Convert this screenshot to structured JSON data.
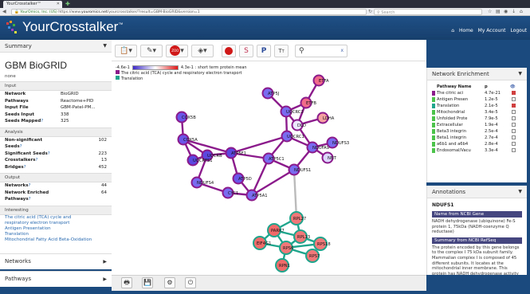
{
  "browser": {
    "tab_title": "YourCrosstalker™",
    "tab_close": "✕",
    "new_tab": "✚",
    "url_org": "YourOmics, Inc. (US)",
    "url_prefix": "https://www.",
    "url_domain": "youromics.net",
    "url_path": "/yourcrosstalker/?result=GBM-BioGRID&version=1",
    "search_placeholder": "Search"
  },
  "header": {
    "title": "YourCrosstalker",
    "trademark": "™",
    "links": [
      "Home",
      "My Account",
      "Logout"
    ]
  },
  "summary": {
    "panel_title": "Summary",
    "dataset_title": "GBM BioGRID",
    "description": "none",
    "input_header": "Input",
    "input_rows": [
      {
        "k": "Network",
        "v": "BioGRID"
      },
      {
        "k": "Pathways",
        "v": "Reactome+PID"
      },
      {
        "k": "Input File",
        "v": "GBM-Patel-PM..."
      },
      {
        "k": "Seeds Input",
        "v": "338"
      },
      {
        "k": "Seeds Mapped",
        "q": "?",
        "v": "325"
      }
    ],
    "analysis_header": "Analysis",
    "analysis_rows": [
      {
        "k": "Non-significant Seeds",
        "q": "?",
        "v": "102"
      },
      {
        "k": "Significant Seeds",
        "q": "?",
        "v": "223"
      },
      {
        "k": "Crosstalkers",
        "q": "?",
        "v": "13"
      },
      {
        "k": "Bridges",
        "q": "?",
        "v": "452"
      }
    ],
    "output_header": "Output",
    "output_rows": [
      {
        "k": "Networks",
        "q": "?",
        "v": "44"
      },
      {
        "k": "Network Enriched Pathways",
        "q": "?",
        "v": "64"
      }
    ],
    "interesting_header": "Interesting",
    "interesting_links": [
      "The citric acid (TCA) cycle and",
      "respiratory electron transport",
      "Antigen Presentation",
      "Translation",
      "Mitochondrial Fatty Acid Beta-Oxidation"
    ],
    "networks_tab": "Networks",
    "pathways_tab": "Pathways"
  },
  "toolbar": {
    "zoom_label": "ZOO",
    "icon_s": "S",
    "icon_p": "P",
    "icon_tt": "T",
    "search_clear": "x"
  },
  "graph": {
    "legend_min": "-4.6e-1",
    "legend_max": "4.3e-1",
    "legend_caption": ": short term protein mean",
    "legend_series": [
      {
        "name": "The citric acid (TCA) cycle and respiratory electron transport",
        "color": "#8b1a8b"
      },
      {
        "name": "Translation",
        "color": "#1fa58c"
      }
    ],
    "nodes": [
      {
        "id": "ETFA",
        "color": "#f06a8a"
      },
      {
        "id": "ATP5J",
        "color": "#7a6cf0"
      },
      {
        "id": "ETFB",
        "color": "#f06a8a"
      },
      {
        "id": "COX5B",
        "color": "#6a56e8"
      },
      {
        "id": "UQCRC2",
        "color": "#7a6cf0"
      },
      {
        "id": "DLD",
        "color": "#ece8ff"
      },
      {
        "id": "LDHA",
        "color": "#f4a0a0"
      },
      {
        "id": "COX5A",
        "color": "#6a56e8"
      },
      {
        "id": "UQCRC1",
        "color": "#7a6cf0"
      },
      {
        "id": "NDUFA9",
        "color": "#7a6cf0"
      },
      {
        "id": "NDUFS3",
        "color": "#7a6cf0"
      },
      {
        "id": "ATP5F1",
        "color": "#5c48e0"
      },
      {
        "id": "UQCRB",
        "color": "#5c48e0"
      },
      {
        "id": "UQCRFS1",
        "color": "#5c48e0"
      },
      {
        "id": "ATP5C1",
        "color": "#7a6cf0"
      },
      {
        "id": "NNT",
        "color": "#ddd8ff"
      },
      {
        "id": "NDUFS1",
        "color": "#7a6cf0"
      },
      {
        "id": "ATP5D",
        "color": "#6a56e8"
      },
      {
        "id": "NDUFS4",
        "color": "#7a6cf0"
      },
      {
        "id": "CYC1",
        "color": "#7a6cf0"
      },
      {
        "id": "ATP5A1",
        "color": "#7a6cf0"
      },
      {
        "id": "RPL27",
        "color": "#f07878"
      },
      {
        "id": "PARK7",
        "color": "#f06a6a"
      },
      {
        "id": "RPL13",
        "color": "#f07878"
      },
      {
        "id": "RPS18",
        "color": "#f07878"
      },
      {
        "id": "EIF4G1",
        "color": "#f06a6a"
      },
      {
        "id": "RPS6",
        "color": "#f07878"
      },
      {
        "id": "RPS7",
        "color": "#f07878"
      },
      {
        "id": "RPN1",
        "color": "#f06a6a"
      }
    ]
  },
  "enrichment": {
    "panel_title": "Network Enrichment",
    "col_name": "Pathway Name",
    "col_p": "p",
    "rows": [
      {
        "name": "The citric aci",
        "p": "4.7e-21",
        "color": "#8b1a8b",
        "checked": true
      },
      {
        "name": "Antigen Presen",
        "p": "1.2e-5",
        "color": "#4cc44c",
        "checked": false
      },
      {
        "name": "Translation",
        "p": "2.1e-5",
        "color": "#1fa58c",
        "checked": true
      },
      {
        "name": "Mitochondrial",
        "p": "3.4e-5",
        "color": "#4cc44c",
        "checked": false
      },
      {
        "name": "Unfolded Prote",
        "p": "7.9e-5",
        "color": "#4cc44c",
        "checked": false
      },
      {
        "name": "Extracellular",
        "p": "1.9e-4",
        "color": "#4cc44c",
        "checked": false
      },
      {
        "name": "Beta3 integrin",
        "p": "2.5e-4",
        "color": "#4cc44c",
        "checked": false
      },
      {
        "name": "Beta1 integrin",
        "p": "2.7e-4",
        "color": "#4cc44c",
        "checked": false
      },
      {
        "name": "a6b1 and a6b4",
        "p": "2.8e-4",
        "color": "#4cc44c",
        "checked": false
      },
      {
        "name": "Endosomal/Vacu",
        "p": "3.3e-4",
        "color": "#4cc44c",
        "checked": false
      }
    ]
  },
  "annotations": {
    "panel_title": "Annotations",
    "gene": "NDUFS1",
    "ncbi_gene_header": "Name from NCBI Gene",
    "ncbi_gene_text": "NADH dehydrogenase (ubiquinone) Fe-S protein 1, 75kDa (NADH-coenzyme Q reductase)",
    "refseq_header": "Summary from NCBI RefSeq",
    "refseq_text": "The protein encoded by this gene belongs to the complex I 75 kDa subunit family. Mammalian complex I is composed of 45 different subunits. It locates at the mitochondrial inner membrane. This protein has NADH dehydrogenase activity and"
  }
}
